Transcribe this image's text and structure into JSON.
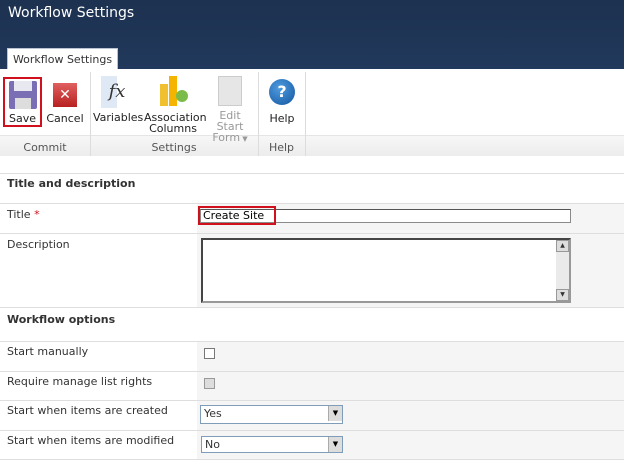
{
  "window": {
    "title": "Workflow Settings"
  },
  "ribbon": {
    "tab": "Workflow Settings",
    "buttons": {
      "save": "Save",
      "cancel": "Cancel",
      "variables": "Variables",
      "association_line1": "Association",
      "association_line2": "Columns",
      "edit_line1": "Edit Start",
      "edit_line2": "Form",
      "help": "Help"
    },
    "groups": {
      "commit": "Commit",
      "settings": "Settings",
      "help": "Help"
    }
  },
  "form": {
    "section1": "Title and description",
    "title_label": "Title",
    "required_mark": "*",
    "title_value": "Create Site",
    "description_label": "Description",
    "description_value": "",
    "section2": "Workflow options",
    "start_manually": "Start manually",
    "start_manually_checked": false,
    "require_rights": "Require manage list rights",
    "require_rights_checked": false,
    "on_create_label": "Start when items are created",
    "on_create_value": "Yes",
    "on_modify_label": "Start when items are modified",
    "on_modify_value": "No"
  },
  "colors": {
    "highlight": "#d0111d",
    "titlebar": "#1d3150"
  }
}
